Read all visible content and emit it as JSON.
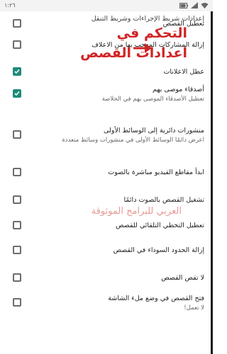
{
  "status_bar": {
    "time": "١:٢٦",
    "wifi_icon": "wifi-icon",
    "signal_icon": "signal-icon",
    "battery_icon": "battery-icon"
  },
  "section_header": "إعدادات شريط الإجراءات وشريط التنقل",
  "overlay": {
    "line1": "التحكم في",
    "line2": "اعدادات القصص",
    "watermark": "العربي للبرامج الموثوقة",
    "color": "#d02525",
    "arrow_icon": "arrow-right-icon"
  },
  "settings": [
    {
      "title": "تعطيل القصص",
      "subtitle": "",
      "checked": false
    },
    {
      "title": "إزالة المشاركات المعجب بها من الاعلاف",
      "subtitle": "",
      "checked": false
    },
    {
      "title": "عطل الاعلانات",
      "subtitle": "",
      "checked": true
    },
    {
      "title": "أصدقاء موصى بهم",
      "subtitle": "تعطيل الأصدقاء الموصى بهم في الخلاصة",
      "checked": true
    },
    {
      "title": "منشورات دائرية إلى الوسائط الأولى",
      "subtitle": "اعرض دائمًا الوسائط الأولى في منشورات وسائط متعددة",
      "checked": false
    },
    {
      "title": "ابدأ مقاطع الفيديو مباشرة بالصوت",
      "subtitle": "",
      "checked": false
    },
    {
      "title": "تشغيل القصص بالصوت دائمًا",
      "subtitle": "",
      "checked": false
    },
    {
      "title": "تعطيل التخطي التلقائي للقصص",
      "subtitle": "",
      "checked": false
    },
    {
      "title": "إزالة الحدود السوداء في القصص",
      "subtitle": "",
      "checked": false
    },
    {
      "title": "لا تقص القصص",
      "subtitle": "",
      "checked": false
    },
    {
      "title": "فتح القصص في وضع ملء الشاشة",
      "subtitle": "لا تعمل!",
      "checked": false
    }
  ],
  "colors": {
    "checkbox_checked": "#1e8a7a",
    "checkbox_unchecked": "#6d6d6d",
    "watermark": "#e79a95"
  }
}
